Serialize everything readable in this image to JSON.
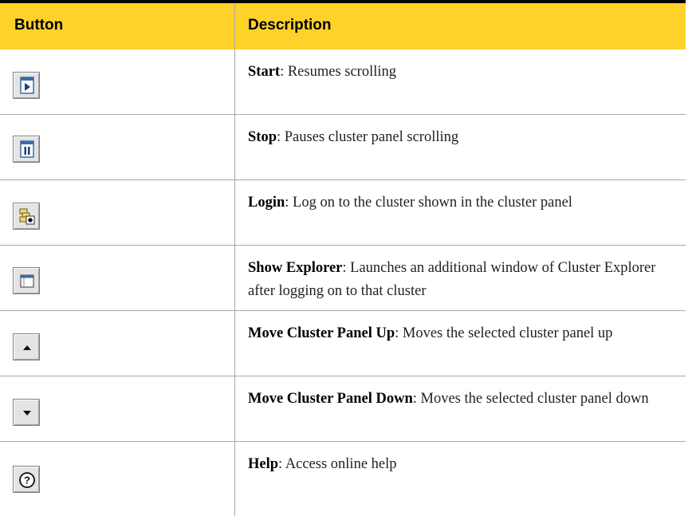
{
  "header": {
    "button_col": "Button",
    "description_col": "Description"
  },
  "rows": [
    {
      "icon": "play-icon",
      "title": "Start",
      "desc": ": Resumes scrolling"
    },
    {
      "icon": "pause-icon",
      "title": "Stop",
      "desc": ": Pauses cluster panel scrolling"
    },
    {
      "icon": "login-icon",
      "title": "Login",
      "desc": ": Log on to the cluster shown in the cluster panel"
    },
    {
      "icon": "window-icon",
      "title": "Show Explorer",
      "desc": ": Launches an additional window of Cluster Explorer after logging on to that cluster"
    },
    {
      "icon": "arrow-up-icon",
      "title": "Move Cluster Panel Up",
      "desc": ": Moves the selected cluster panel up"
    },
    {
      "icon": "arrow-down-icon",
      "title": "Move Cluster Panel Down",
      "desc": ": Moves the selected cluster panel down"
    },
    {
      "icon": "help-icon",
      "title": "Help",
      "desc": ": Access online help"
    }
  ]
}
